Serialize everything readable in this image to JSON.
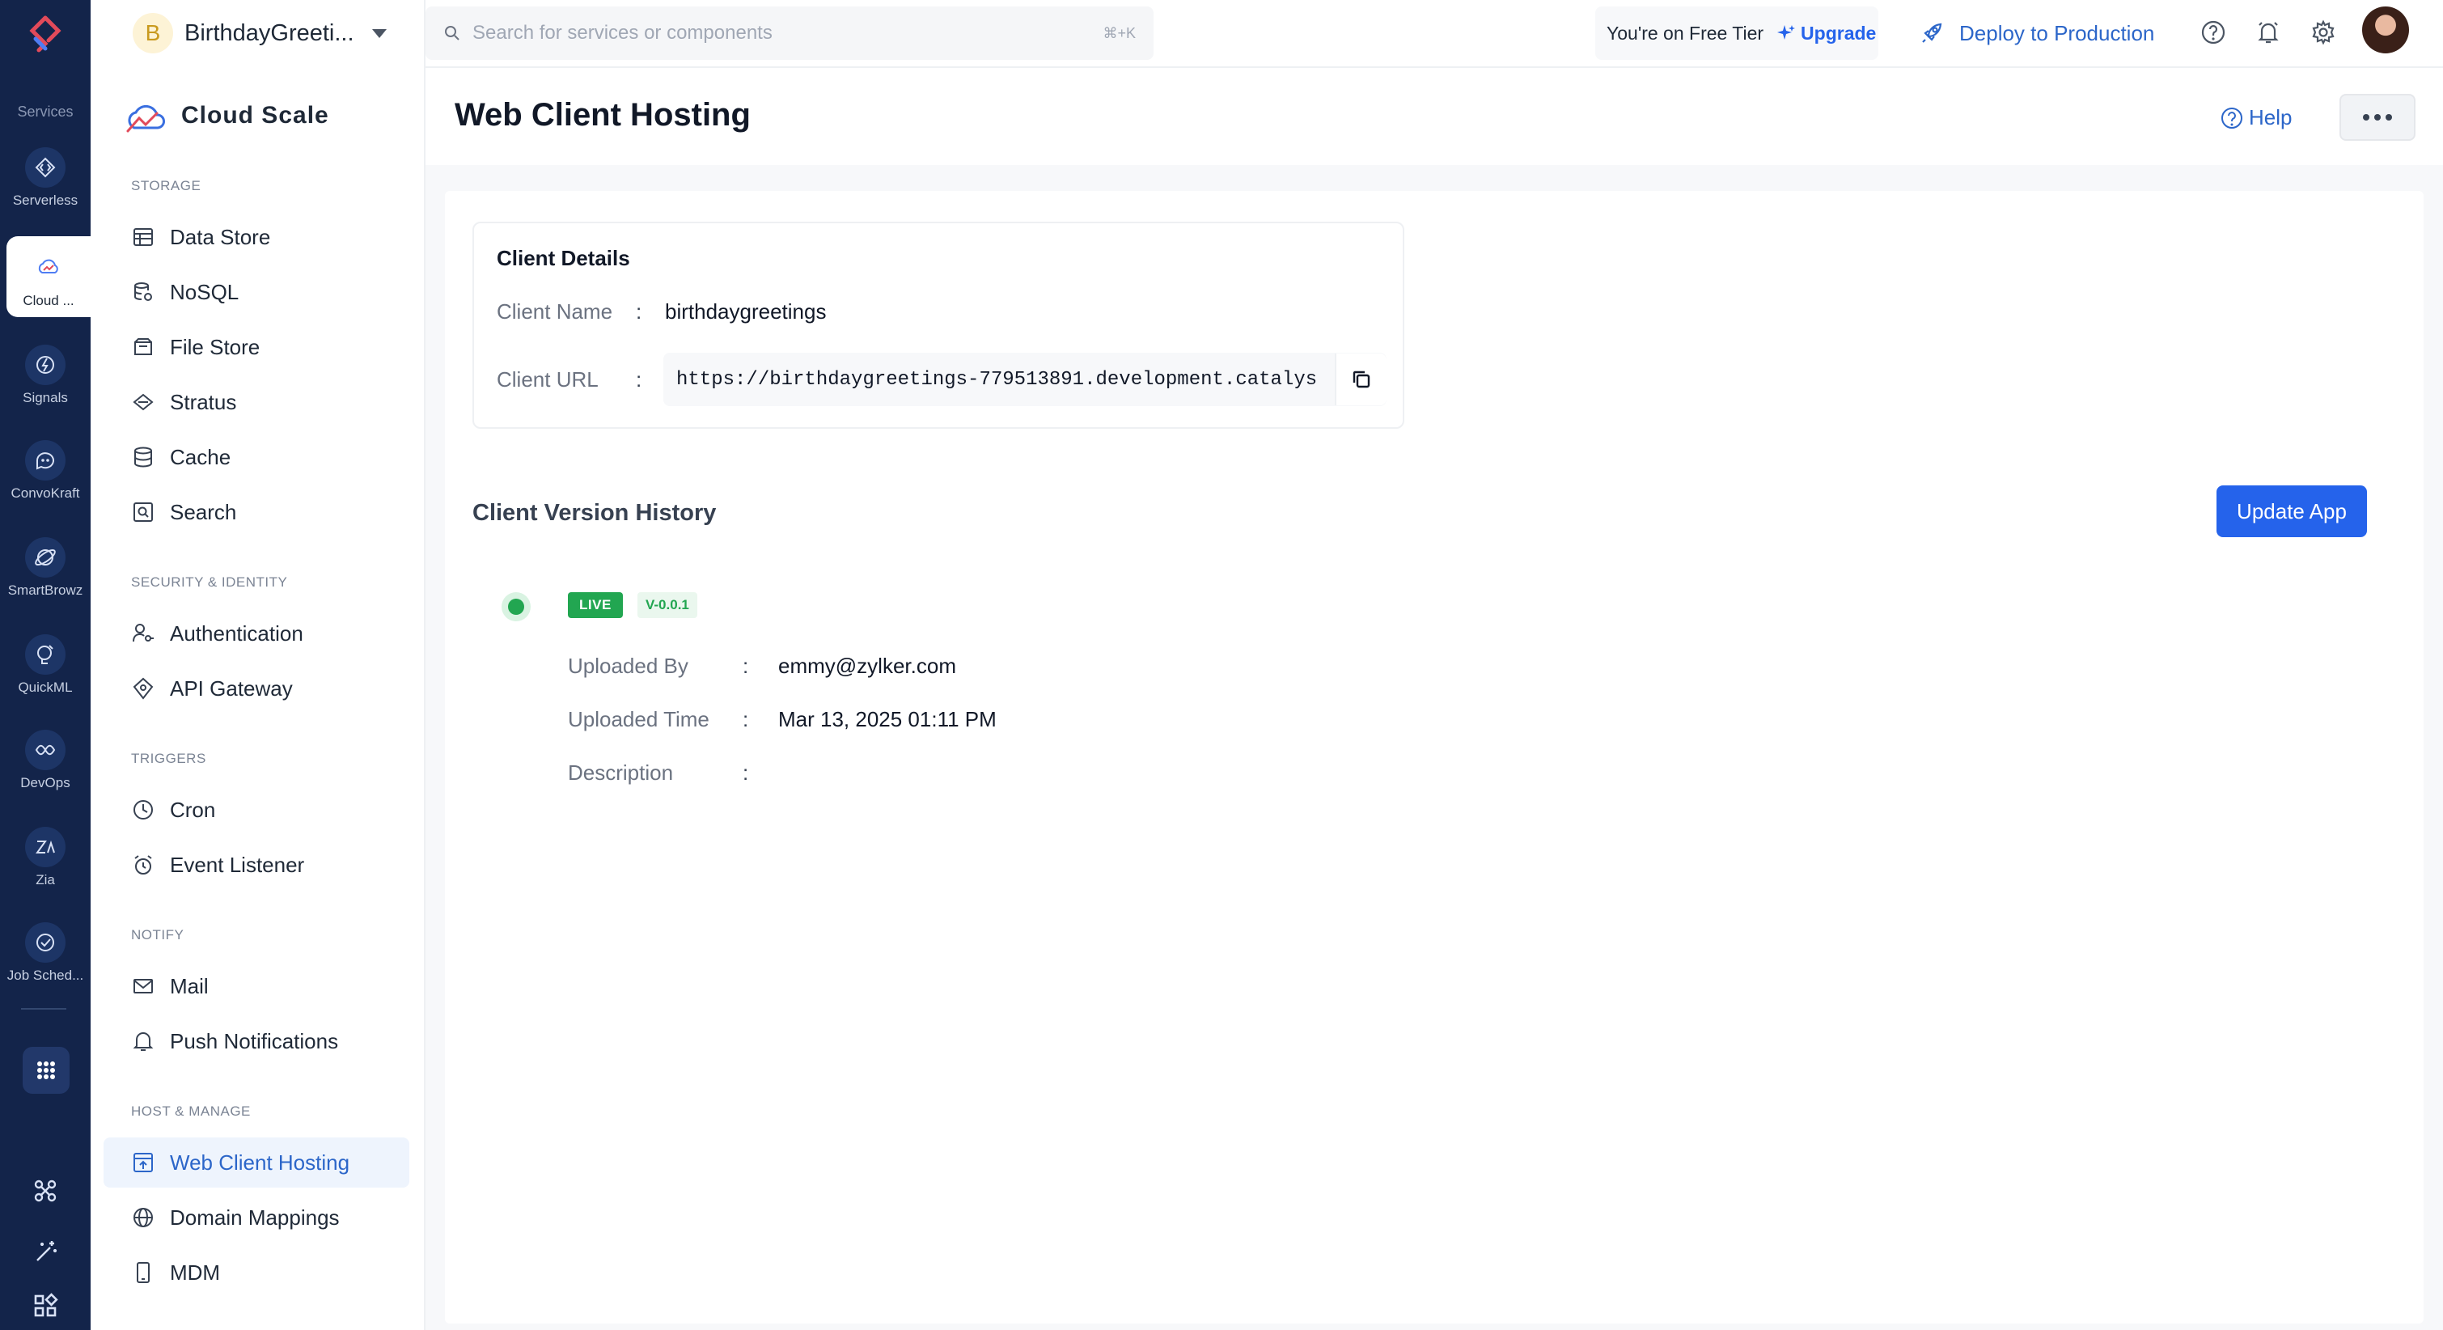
{
  "rail": {
    "section_label": "Services",
    "items": [
      {
        "label": "Serverless",
        "icon": "serverless-icon"
      },
      {
        "label": "Cloud ...",
        "icon": "cloud-scale-icon"
      },
      {
        "label": "Signals",
        "icon": "signals-icon"
      },
      {
        "label": "ConvoKraft",
        "icon": "convokraft-icon"
      },
      {
        "label": "SmartBrowz",
        "icon": "smartbrowz-icon"
      },
      {
        "label": "QuickML",
        "icon": "quickml-icon"
      },
      {
        "label": "DevOps",
        "icon": "devops-icon"
      },
      {
        "label": "Zia",
        "icon": "zia-icon"
      },
      {
        "label": "Job Sched...",
        "icon": "job-scheduling-icon"
      }
    ]
  },
  "project": {
    "initial": "B",
    "name": "BirthdayGreeti..."
  },
  "brand": {
    "name": "Cloud Scale"
  },
  "sidebar": {
    "groups": [
      {
        "heading": "STORAGE",
        "items": [
          "Data Store",
          "NoSQL",
          "File Store",
          "Stratus",
          "Cache",
          "Search"
        ]
      },
      {
        "heading": "SECURITY & IDENTITY",
        "items": [
          "Authentication",
          "API Gateway"
        ]
      },
      {
        "heading": "TRIGGERS",
        "items": [
          "Cron",
          "Event Listener"
        ]
      },
      {
        "heading": "NOTIFY",
        "items": [
          "Mail",
          "Push Notifications"
        ]
      },
      {
        "heading": "HOST & MANAGE",
        "items": [
          "Web Client Hosting",
          "Domain Mappings",
          "MDM"
        ]
      }
    ],
    "active": "Web Client Hosting"
  },
  "topbar": {
    "search_placeholder": "Search for services or components",
    "search_shortcut": "⌘+K",
    "tier_text": "You're on Free Tier",
    "upgrade_label": "Upgrade",
    "deploy_label": "Deploy to Production"
  },
  "header": {
    "title": "Web Client Hosting",
    "help_label": "Help"
  },
  "client_details": {
    "title": "Client Details",
    "name_label": "Client Name",
    "name_value": "birthdaygreetings",
    "url_label": "Client URL",
    "url_value": "https://birthdaygreetings-779513891.development.catalys"
  },
  "history": {
    "title": "Client Version History",
    "update_label": "Update App",
    "status_badge": "LIVE",
    "version": "V-0.0.1",
    "uploaded_by_label": "Uploaded By",
    "uploaded_by_value": "emmy@zylker.com",
    "uploaded_time_label": "Uploaded Time",
    "uploaded_time_value": "Mar 13, 2025 01:11 PM",
    "description_label": "Description",
    "description_value": ""
  },
  "colors": {
    "rail_bg": "#13244a",
    "accent": "#2563eb",
    "live": "#22a651"
  }
}
